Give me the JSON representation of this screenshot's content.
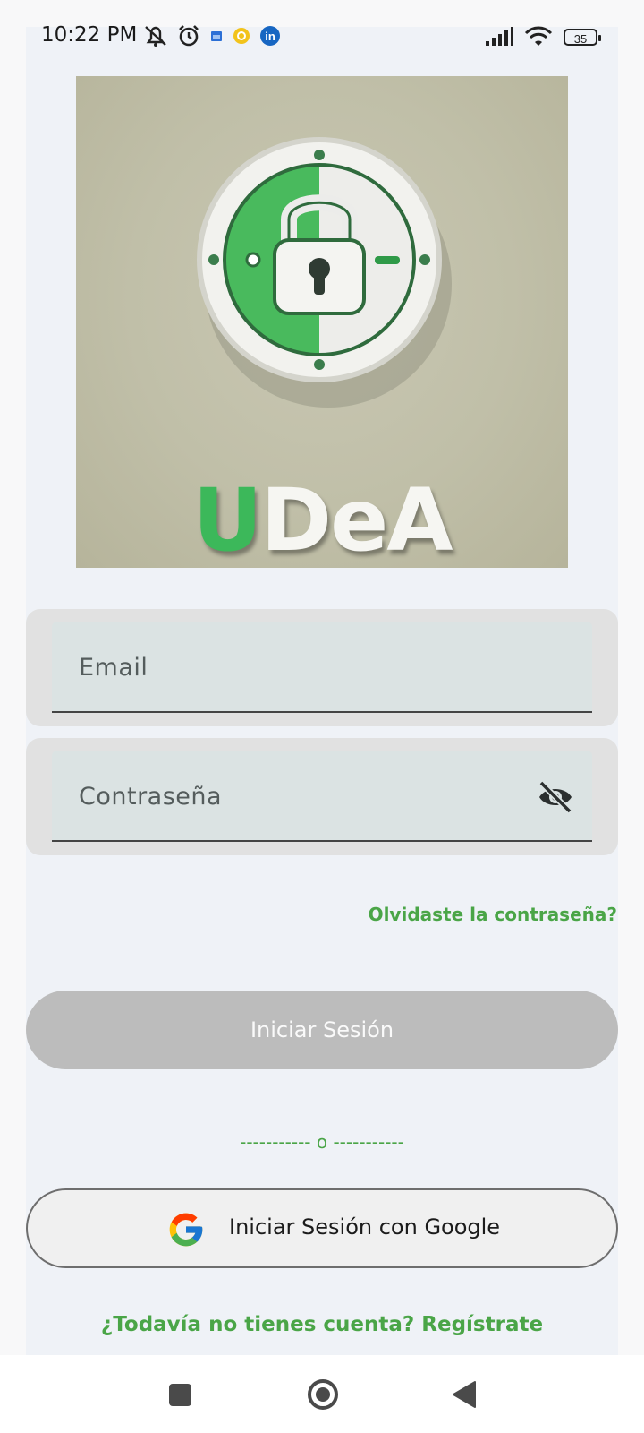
{
  "status_bar": {
    "time": "10:22 PM",
    "left_icons": [
      "mute-notification-icon",
      "alarm-icon",
      "calendar-icon",
      "notification-dot-icon",
      "linkedin-icon"
    ],
    "right_icons": [
      "signal-icon",
      "wifi-icon",
      "battery-icon"
    ],
    "battery_level": "35"
  },
  "logo": {
    "text_green": "U",
    "text_white": "DeA",
    "colors": {
      "green": "#3cb85a",
      "background": "#c2c0a9"
    }
  },
  "form": {
    "email_placeholder": "Email",
    "password_placeholder": "Contraseña",
    "password_toggle_icon": "eye-off-icon",
    "forgot_link": "Olvidaste la contraseña?",
    "login_button": "Iniciar Sesión",
    "divider_text": "----------- o -----------",
    "google_button": "Iniciar Sesión con Google",
    "register_link": "¿Todavía no tienes cuenta? Regístrate"
  },
  "theme": {
    "accent": "#4aa547",
    "disabled_button": "#bcbcbc"
  },
  "nav_bar": {
    "icons": [
      "recents-icon",
      "home-icon",
      "back-icon"
    ]
  }
}
